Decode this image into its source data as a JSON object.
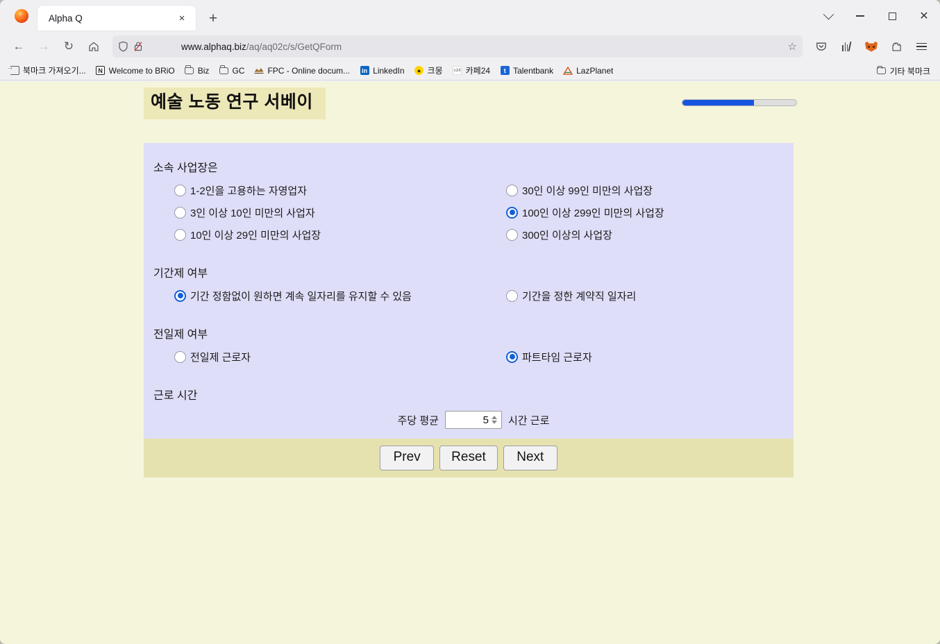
{
  "browser": {
    "window_controls": {
      "tab_list": "tab-list-chevron",
      "minimize": "minimize",
      "maximize": "maximize",
      "close": "close"
    },
    "tab": {
      "title": "Alpha Q",
      "close_label": "×",
      "newtab_label": "+"
    },
    "nav": {
      "back": "←",
      "forward": "→",
      "reload": "↻",
      "home": "⌂"
    },
    "urlbar": {
      "host": "www.alphaq.biz",
      "path": "/aq/aq02c/s/GetQForm",
      "full_url": "www.alphaq.biz/aq/aq02c/s/GetQForm",
      "bookmark_star": "☆"
    },
    "toolbar_icons": [
      "pocket-icon",
      "library-icon",
      "mask-extension-icon",
      "extensions-icon",
      "app-menu-icon"
    ],
    "bookmarks": [
      {
        "label": "북마크 가져오기...",
        "icon": "import-bookmarks-icon",
        "color": "#5b5b66"
      },
      {
        "label": "Welcome to BRiO",
        "icon": "notion-icon",
        "color": "#111111"
      },
      {
        "label": "Biz",
        "icon": "folder-icon",
        "color": "#5b5b66"
      },
      {
        "label": "GC",
        "icon": "folder-icon",
        "color": "#5b5b66"
      },
      {
        "label": "FPC - Online docum...",
        "icon": "fpc-icon",
        "color": "#8a5a2a"
      },
      {
        "label": "LinkedIn",
        "icon": "linkedin-icon",
        "color": "#0a66c2"
      },
      {
        "label": "크몽",
        "icon": "kmong-icon",
        "color": "#ffd400"
      },
      {
        "label": "카페24",
        "icon": "cafe24-icon",
        "color": "#e8e8e8"
      },
      {
        "label": "Talentbank",
        "icon": "talentbank-icon",
        "color": "#1a64d6"
      },
      {
        "label": "LazPlanet",
        "icon": "lazplanet-icon",
        "color": "#e06030"
      }
    ],
    "other_bookmarks": {
      "label": "기타 북마크",
      "icon": "folder-icon"
    }
  },
  "survey": {
    "title": "예술 노동 연구 서베이",
    "progress": {
      "percent": 63,
      "fill_color": "#1456e0",
      "track_color": "#dedede"
    },
    "panel_color": "#dfdef8",
    "page_bg_color": "#f5f5dc",
    "banner_color": "#ede8b8",
    "questions": [
      {
        "label": "소속 사업장은",
        "name": "workplace-size",
        "options": [
          {
            "label": "1-2인을 고용하는 자영업자",
            "checked": false
          },
          {
            "label": "30인 이상 99인 미만의 사업장",
            "checked": false
          },
          {
            "label": "3인 이상 10인 미만의 사업자",
            "checked": false
          },
          {
            "label": "100인 이상 299인 미만의 사업장",
            "checked": true
          },
          {
            "label": "10인 이상 29인 미만의 사업장",
            "checked": false
          },
          {
            "label": "300인 이상의 사업장",
            "checked": false
          }
        ]
      },
      {
        "label": "기간제 여부",
        "name": "fixed-term",
        "options": [
          {
            "label": "기간 정함없이 원하면 계속 일자리를 유지할 수 있음",
            "checked": true
          },
          {
            "label": "기간을 정한 계약직 일자리",
            "checked": false
          }
        ]
      },
      {
        "label": "전일제 여부",
        "name": "fulltime",
        "options": [
          {
            "label": "전일제 근로자",
            "checked": false
          },
          {
            "label": "파트타임 근로자",
            "checked": true
          }
        ]
      }
    ],
    "hours": {
      "label": "근로 시간",
      "prefix": "주당 평균",
      "value": "5",
      "suffix": "시간 근로"
    },
    "buttons": {
      "prev": "Prev",
      "reset": "Reset",
      "next": "Next"
    }
  }
}
